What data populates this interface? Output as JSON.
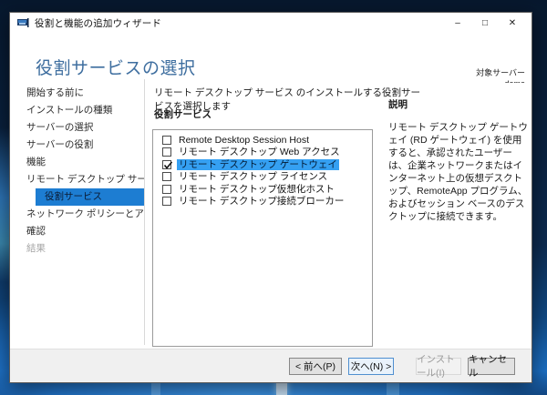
{
  "window": {
    "title": "役割と機能の追加ウィザード",
    "caption": {
      "minimize": "–",
      "maximize": "□",
      "close": "✕"
    }
  },
  "header": {
    "title": "役割サービスの選択",
    "target_server_label": "対象サーバー",
    "target_server_name": "doma"
  },
  "sidebar": {
    "items": [
      {
        "label": "開始する前に",
        "state": "enabled"
      },
      {
        "label": "インストールの種類",
        "state": "enabled"
      },
      {
        "label": "サーバーの選択",
        "state": "enabled"
      },
      {
        "label": "サーバーの役割",
        "state": "enabled"
      },
      {
        "label": "機能",
        "state": "enabled"
      },
      {
        "label": "リモート デスクトップ サービス",
        "state": "enabled"
      },
      {
        "label": "役割サービス",
        "state": "selected"
      },
      {
        "label": "ネットワーク ポリシーとアクセ...",
        "state": "enabled"
      },
      {
        "label": "確認",
        "state": "enabled"
      },
      {
        "label": "結果",
        "state": "disabled"
      }
    ]
  },
  "main": {
    "instruction": "リモート デスクトップ サービス のインストールする役割サービスを選択します",
    "list_label": "役割サービス",
    "check_glyph": "✓",
    "role_services": [
      {
        "label": "Remote Desktop Session Host",
        "checked": false,
        "selected": false
      },
      {
        "label": "リモート デスクトップ Web アクセス",
        "checked": false,
        "selected": false
      },
      {
        "label": "リモート デスクトップ ゲートウェイ",
        "checked": true,
        "selected": true
      },
      {
        "label": "リモート デスクトップ ライセンス",
        "checked": false,
        "selected": false
      },
      {
        "label": "リモート デスクトップ仮想化ホスト",
        "checked": false,
        "selected": false
      },
      {
        "label": "リモート デスクトップ接続ブローカー",
        "checked": false,
        "selected": false
      }
    ]
  },
  "description": {
    "title": "説明",
    "text": "リモート デスクトップ ゲートウェイ (RD ゲートウェイ) を使用すると、承認されたユーザーは、企業ネットワークまたはインターネット上の仮想デスクトップ、RemoteApp プログラム、およびセッション ベースのデスクトップに接続できます。"
  },
  "footer": {
    "previous": "< 前へ(P)",
    "next": "次へ(N) >",
    "install": "インストール(I)",
    "cancel": "キャンセル"
  },
  "colors": {
    "sidebar_selected_bg": "#1d7dd2",
    "list_selected_bg": "#35a0f2",
    "heading_blue": "#3e6e9f",
    "next_button_border": "#4f8fd0",
    "desktop_bright_blue": "#1b6fc4"
  }
}
